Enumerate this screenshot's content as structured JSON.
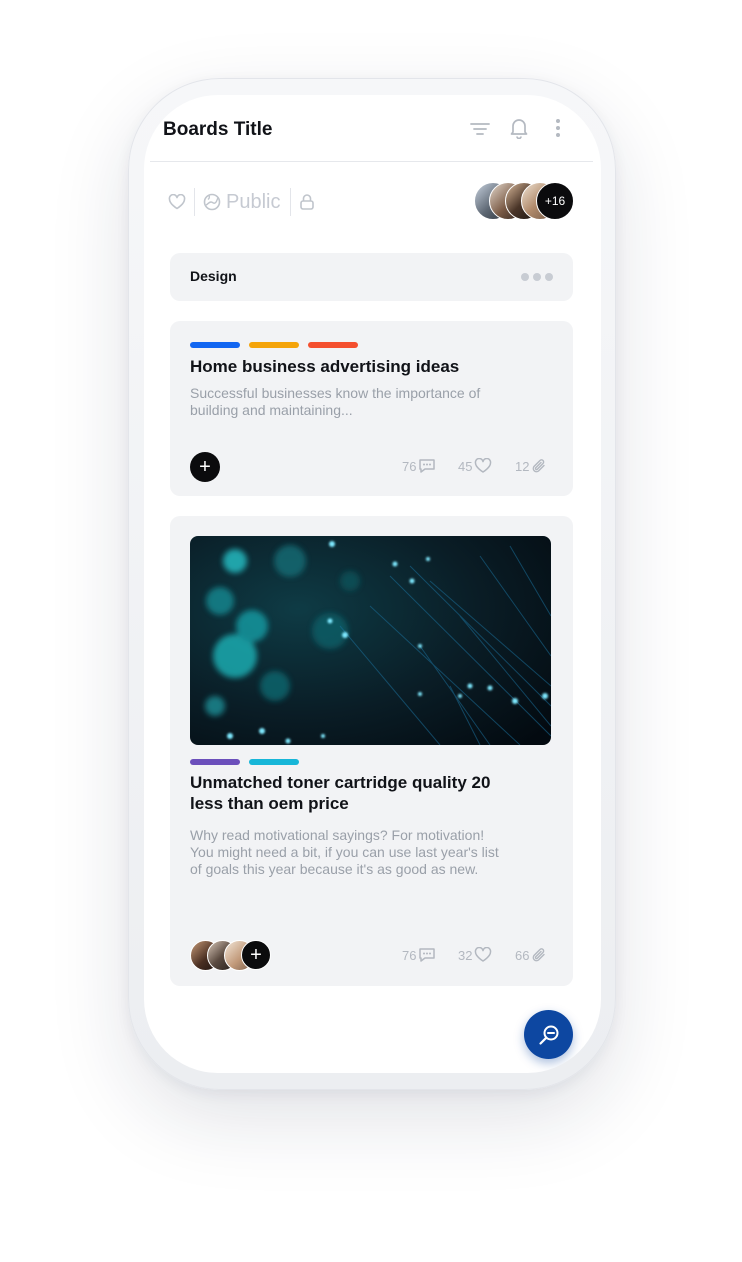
{
  "header": {
    "title": "Boards Title",
    "icons": [
      "filter-icon",
      "bell-icon",
      "more-vertical-icon"
    ]
  },
  "meta": {
    "visibility_label": "Public",
    "icons": [
      "heart-icon",
      "globe-icon",
      "lock-icon"
    ],
    "members_more": "+16"
  },
  "section": {
    "label": "Design",
    "menu_icon": "more-horizontal-icon"
  },
  "cards": [
    {
      "tags": [
        "#1266f1",
        "#f4a40a",
        "#f44f2e"
      ],
      "title": "Home business advertising ideas",
      "description": "Successful businesses know the importance of building and maintaining...",
      "comments": "76",
      "likes": "45",
      "attachments": "12"
    },
    {
      "tags": [
        "#6b4fbb",
        "#17b6d8"
      ],
      "title": "Unmatched toner cartridge quality 20 less than oem price",
      "description": "Why read motivational sayings? For motivation! You might need a bit, if you can use last year's list of goals this year because it's as good as new.",
      "comments": "76",
      "likes": "32",
      "attachments": "66"
    }
  ],
  "colors": {
    "accent": "#0d47a1",
    "card_bg": "#f2f3f5",
    "text_primary": "#111318",
    "text_muted": "#9aa0a9"
  }
}
